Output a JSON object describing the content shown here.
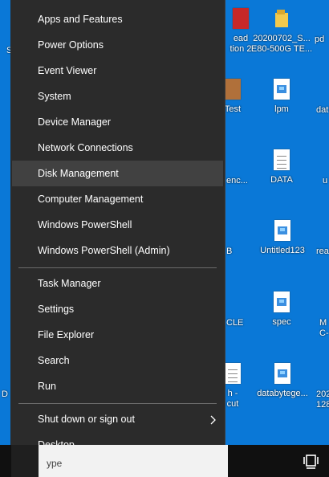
{
  "desktop": {
    "icons": [
      {
        "label": "ead",
        "label2": "tion 2"
      },
      {
        "label": "20200702_S...",
        "label2": "E80-500G TE..."
      },
      {
        "label": "pd"
      },
      {
        "label": "Test"
      },
      {
        "label": "lpm"
      },
      {
        "label": "dat"
      },
      {
        "label": "enc..."
      },
      {
        "label": "DATA"
      },
      {
        "label": "u"
      },
      {
        "label": "B"
      },
      {
        "label": "Untitled123"
      },
      {
        "label": "rea"
      },
      {
        "label": "CLE"
      },
      {
        "label": "spec"
      },
      {
        "label": "M",
        "label2": "C-"
      },
      {
        "label": "h -",
        "label2": "cut"
      },
      {
        "label": "databytege..."
      },
      {
        "label": "202",
        "label2": "128"
      },
      {
        "label": "S"
      },
      {
        "label": "D"
      }
    ]
  },
  "menu": {
    "group1": [
      "Apps and Features",
      "Power Options",
      "Event Viewer",
      "System",
      "Device Manager",
      "Network Connections",
      "Disk Management",
      "Computer Management",
      "Windows PowerShell",
      "Windows PowerShell (Admin)"
    ],
    "group2": [
      "Task Manager",
      "Settings",
      "File Explorer",
      "Search",
      "Run"
    ],
    "group3": [
      "Shut down or sign out",
      "Desktop"
    ],
    "highlighted": "Disk Management"
  },
  "taskbar": {
    "search_stub": "ype"
  },
  "colors": {
    "desktop_bg": "#0a78d7",
    "menu_bg": "#2b2b2b",
    "menu_hover": "#414141",
    "taskbar_bg": "#101010"
  }
}
